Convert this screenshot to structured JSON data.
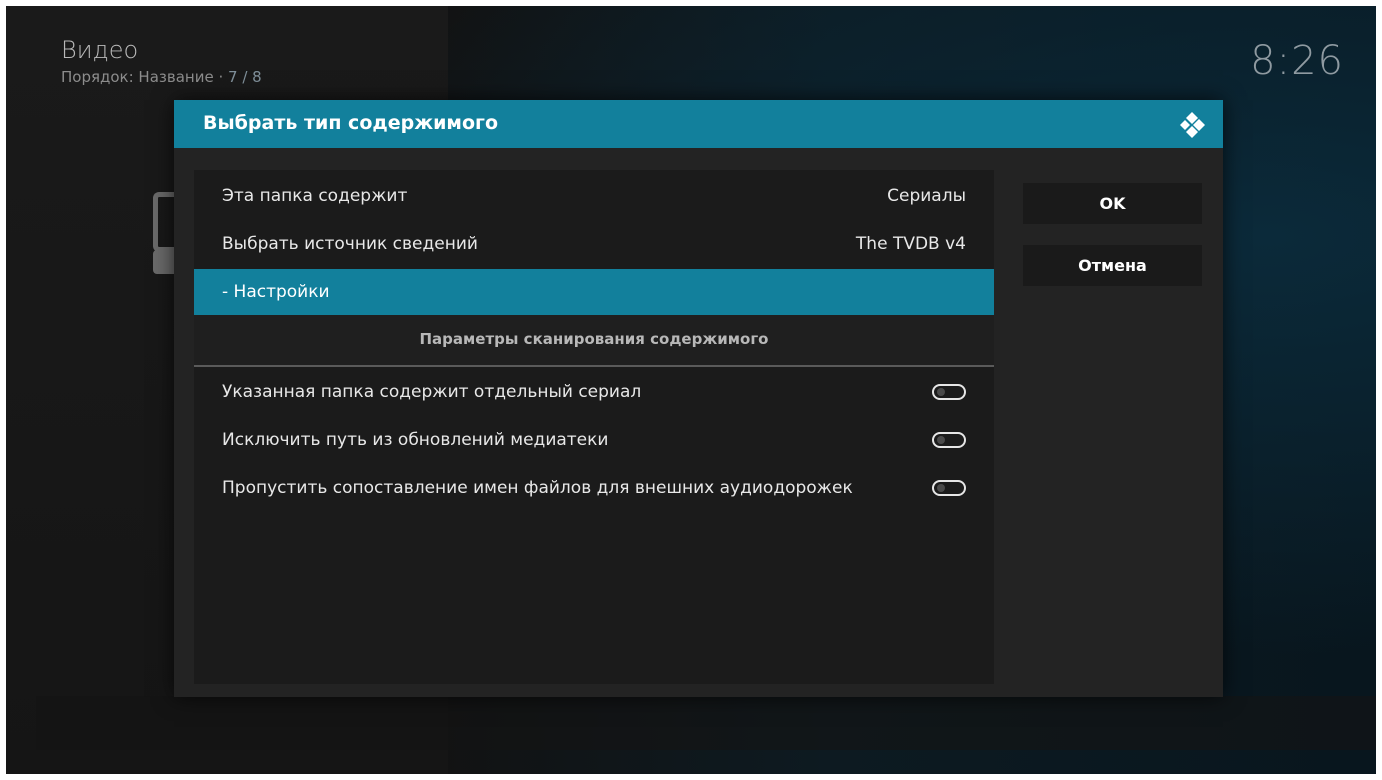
{
  "header": {
    "title": "Видео",
    "sort_label": "Порядок: Название",
    "separator": "·",
    "count": "7 / 8"
  },
  "clock": "8:26",
  "dialog": {
    "title": "Выбрать тип содержимого",
    "rows": [
      {
        "label": "Эта папка содержит",
        "value": "Сериалы"
      },
      {
        "label": "Выбрать источник сведений",
        "value": "The TVDB v4"
      },
      {
        "label": "- Настройки",
        "focused": true
      }
    ],
    "section_heading": "Параметры сканирования содержимого",
    "toggles": [
      {
        "label": "Указанная папка содержит отдельный сериал",
        "enabled": false
      },
      {
        "label": "Исключить путь из обновлений медиатеки",
        "enabled": false
      },
      {
        "label": "Пропустить сопоставление имен файлов для внешних аудиодорожек",
        "enabled": false
      }
    ],
    "buttons": {
      "ok": "OK",
      "cancel": "Отмена"
    }
  },
  "colors": {
    "accent": "#12809c",
    "dialog_bg": "#232323",
    "list_bg": "#1b1b1b"
  },
  "icons": {
    "brand": "kodi-logo-icon"
  }
}
